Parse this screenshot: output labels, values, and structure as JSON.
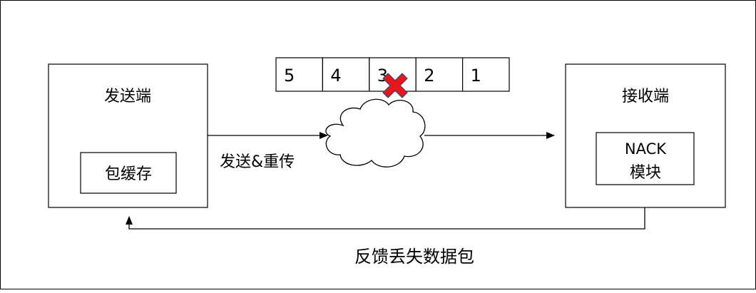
{
  "sender": {
    "title": "发送端",
    "buffer_label": "包缓存"
  },
  "receiver": {
    "title": "接收端",
    "nack_line1": "NACK",
    "nack_line2": "模块"
  },
  "packet_queue": [
    "5",
    "4",
    "3",
    "2",
    "1"
  ],
  "lost_packet": "3",
  "send_label": "发送&重传",
  "feedback_label": "反馈丢失数据包",
  "colors": {
    "line": "#000000",
    "lost_marker": "#e8161b",
    "lost_marker_outline": "#2e4a7d",
    "background": "#ffffff"
  },
  "icons": {
    "network": "cloud-icon",
    "lost": "lost-packet-x-icon"
  }
}
